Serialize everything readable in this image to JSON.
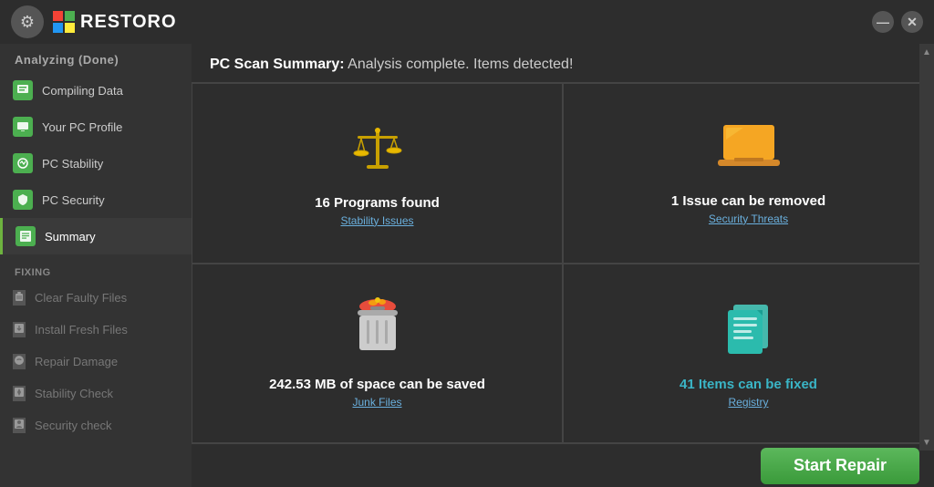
{
  "titlebar": {
    "status": "Analyzing (Done)",
    "app_name": "RESTORO",
    "gear_icon": "⚙",
    "minimize_icon": "—",
    "close_icon": "✕"
  },
  "sidebar": {
    "analyzing_header": "Analyzing (Done)",
    "items": [
      {
        "id": "compiling-data",
        "label": "Compiling Data",
        "icon": "📋",
        "icon_type": "green",
        "active": false
      },
      {
        "id": "pc-profile",
        "label": "Your PC Profile",
        "icon": "💻",
        "icon_type": "blue",
        "active": false
      },
      {
        "id": "pc-stability",
        "label": "PC Stability",
        "icon": "📊",
        "icon_type": "orange",
        "active": false
      },
      {
        "id": "pc-security",
        "label": "PC Security",
        "icon": "🔒",
        "icon_type": "green",
        "active": false
      },
      {
        "id": "summary",
        "label": "Summary",
        "icon": "📄",
        "icon_type": "green",
        "active": true
      }
    ],
    "fixing_header": "Fixing",
    "fixing_items": [
      {
        "id": "clear-faulty",
        "label": "Clear Faulty Files",
        "icon": "🗑",
        "disabled": true
      },
      {
        "id": "install-fresh",
        "label": "Install Fresh Files",
        "icon": "📥",
        "disabled": true
      },
      {
        "id": "repair-damage",
        "label": "Repair Damage",
        "icon": "⚙",
        "disabled": true
      },
      {
        "id": "stability-check",
        "label": "Stability Check",
        "icon": "🔒",
        "disabled": true
      },
      {
        "id": "security-check",
        "label": "Security check",
        "icon": "🔑",
        "disabled": true
      }
    ]
  },
  "main": {
    "summary_prefix": "PC Scan Summary:",
    "summary_text": " Analysis complete. Items detected!",
    "cards": [
      {
        "id": "programs",
        "title": "16 Programs found",
        "subtitle": "Stability Issues",
        "icon_type": "scales"
      },
      {
        "id": "security",
        "title": "1 Issue can be removed",
        "subtitle": "Security Threats",
        "icon_type": "laptop"
      },
      {
        "id": "junk",
        "title": "242.53 MB of space can be saved",
        "subtitle": "Junk Files",
        "icon_type": "trash"
      },
      {
        "id": "registry",
        "title": "41 Items can be fixed",
        "subtitle": "Registry",
        "icon_type": "docs"
      }
    ],
    "start_repair_label": "Start Repair"
  }
}
